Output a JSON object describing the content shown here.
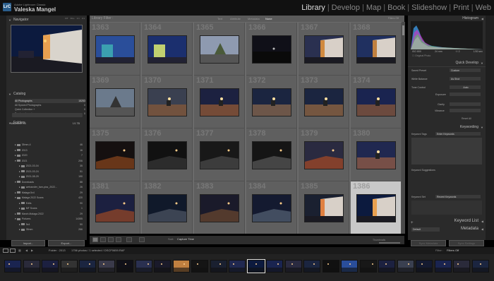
{
  "app": {
    "brand_top": "Adobe Lightroom Classic",
    "user_name": "Valeska Mangel",
    "logo_text": "LrC",
    "modules": [
      "Library",
      "Develop",
      "Map",
      "Book",
      "Slideshow",
      "Print",
      "Web"
    ],
    "active_module": "Library"
  },
  "left_panel": {
    "navigator": {
      "title": "Navigator",
      "zoom_options": [
        "FIT",
        "FILL",
        "1:1",
        "3:1"
      ]
    },
    "catalog": {
      "title": "Catalog",
      "items": [
        {
          "label": "All Photographs",
          "count": "15253"
        },
        {
          "label": "All Synced Photographs",
          "count": "0"
        },
        {
          "label": "Quick Collection +",
          "count": "0"
        },
        {
          "label": "Previous Import",
          "count": "0"
        }
      ]
    },
    "folders": {
      "title": "Folders",
      "volume": "Macintosh HD",
      "volume_space": "1/1 TB",
      "items": [
        {
          "label": "35mm-4",
          "count": "46"
        },
        {
          "label": "2013",
          "count": "16"
        },
        {
          "label": "2020",
          "count": "7"
        },
        {
          "label": "2021",
          "count": "206"
        },
        {
          "label": "2021-03-04",
          "count": "35"
        },
        {
          "label": "2021-03-24",
          "count": "51"
        },
        {
          "label": "2021-08-29",
          "count": "190"
        },
        {
          "label": "Downloads",
          "count": "88"
        },
        {
          "label": "wetransfer_fam-pics_2022...",
          "count": "26"
        },
        {
          "label": "Malaga.5x4",
          "count": "29"
        },
        {
          "label": "Malaga 2022 Scans",
          "count": "420"
        },
        {
          "label": "Edits",
          "count": "90"
        },
        {
          "label": "MF Scans",
          "count": "1"
        },
        {
          "label": "March.Malaga.2022",
          "count": "29"
        },
        {
          "label": "Pictures",
          "count": "14355"
        },
        {
          "label": "5x4",
          "count": "50"
        },
        {
          "label": "35mm",
          "count": "266"
        }
      ]
    },
    "import_label": "Import...",
    "export_label": "Export..."
  },
  "grid": {
    "title": "Library Filter :",
    "filters": [
      "Text",
      "Attribute",
      "Metadata",
      "None"
    ],
    "active_filter": "None",
    "filters_off": "Filters Off",
    "cells": [
      {
        "num": "1363"
      },
      {
        "num": "1364"
      },
      {
        "num": "1365"
      },
      {
        "num": "1366"
      },
      {
        "num": "1367"
      },
      {
        "num": "1368"
      },
      {
        "num": "1369"
      },
      {
        "num": "1370"
      },
      {
        "num": "1371"
      },
      {
        "num": "1372"
      },
      {
        "num": "1373"
      },
      {
        "num": "1374"
      },
      {
        "num": "1375"
      },
      {
        "num": "1376"
      },
      {
        "num": "1377"
      },
      {
        "num": "1378"
      },
      {
        "num": "1379"
      },
      {
        "num": "1380"
      },
      {
        "num": "1381"
      },
      {
        "num": "1382"
      },
      {
        "num": "1383"
      },
      {
        "num": "1384"
      },
      {
        "num": "1385"
      },
      {
        "num": "1386"
      }
    ],
    "selected_index": 23
  },
  "toolbar": {
    "sort_label": "Sort:",
    "sort_value": "Capture Time",
    "thumbnails_label": "Thumbnails"
  },
  "right_panel": {
    "histogram": {
      "title": "Histogram",
      "info": [
        "ISO 800",
        "24 mm",
        "f / 2",
        "1/30 sec"
      ],
      "original_photo": "Original Photo"
    },
    "quick_develop": {
      "title": "Quick Develop",
      "saved_preset_label": "Saved Preset",
      "saved_preset_value": "Custom",
      "white_balance_label": "White Balance",
      "white_balance_value": "As Shot",
      "tone_control_label": "Tone Control",
      "tone_control_value": "Auto",
      "sliders": [
        "Exposure",
        "Clarity",
        "Vibrance"
      ],
      "reset_all": "Reset All"
    },
    "keywording": {
      "title": "Keywording",
      "keyword_tags_label": "Keyword Tags",
      "keyword_tags_value": "Enter Keywords",
      "suggestions_label": "Keyword Suggestions",
      "keyword_set_label": "Keyword Set",
      "keyword_set_value": "Recent Keywords"
    },
    "keyword_list": {
      "title": "Keyword List"
    },
    "metadata": {
      "title": "Metadata",
      "preset": "Default"
    },
    "sync_metadata": "Sync Metadata",
    "sync_settings": "Sync Settings"
  },
  "filmstrip": {
    "folder_label": "Folder : 2013",
    "count_text": "1756 photos / 1 selected / DSCF0659.RAF",
    "filter_label": "Filter :",
    "filter_value": "Filters Off"
  }
}
